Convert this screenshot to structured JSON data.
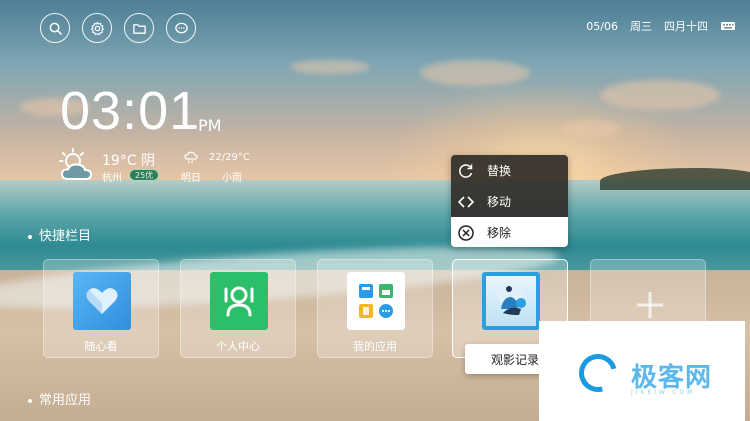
{
  "status": {
    "date": "05/06",
    "weekday": "周三",
    "lunar": "四月十四"
  },
  "clock": {
    "time": "03:01",
    "ampm": "PM"
  },
  "weather": {
    "current_temp": "19°C 阴",
    "city": "杭州",
    "aqi": "25优",
    "forecast_temp": "22/29°C",
    "forecast_day": "明日",
    "forecast_desc": "小雨"
  },
  "sections": {
    "shortcuts": "快捷栏目",
    "common_apps": "常用应用"
  },
  "tiles": [
    {
      "label": "随心看",
      "color": "#4aa7ea"
    },
    {
      "label": "个人中心",
      "color": "#2bbf6a"
    },
    {
      "label": "我的应用",
      "color": "#ffffff"
    },
    {
      "label": "观影记录",
      "color": "#2aa0e0"
    }
  ],
  "context_menu": {
    "items": [
      {
        "label": "替换",
        "icon": "refresh-icon"
      },
      {
        "label": "移动",
        "icon": "code-brackets-icon"
      },
      {
        "label": "移除",
        "icon": "close-circle-icon"
      }
    ]
  },
  "watermark": {
    "brand": "极客网",
    "sub": "JIKEIW.COM"
  },
  "colors": {
    "aqi_badge": "#2f7d59",
    "accent_blue": "#1a9be0"
  }
}
